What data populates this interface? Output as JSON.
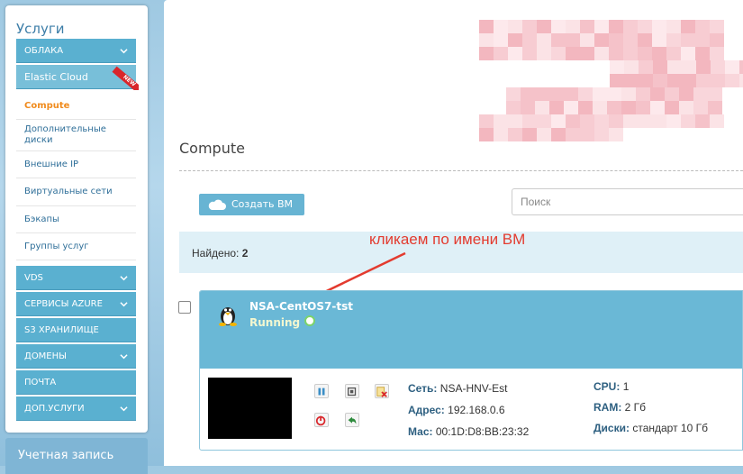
{
  "sidebar": {
    "title": "Услуги",
    "items": [
      {
        "label": "ОБЛАКА"
      },
      {
        "label": "Elastic Cloud",
        "badge": "NEW"
      }
    ],
    "subitems": [
      "Compute",
      "Дополнительные диски",
      "Внешние IP",
      "Виртуальные сети",
      "Бэкапы",
      "Группы услуг"
    ],
    "bottom_items": [
      "VDS",
      "СЕРВИСЫ AZURE",
      "S3 ХРАНИЛИЩЕ",
      "ДОМЕНЫ",
      "ПОЧТА",
      "ДОП.УСЛУГИ"
    ],
    "account_label": "Учетная запись"
  },
  "main": {
    "page_title": "Compute",
    "create_button": "Создать ВМ",
    "search_placeholder": "Поиск",
    "found_label": "Найдено:",
    "found_count": "2",
    "annotation": "кликаем по имени ВМ"
  },
  "vm": {
    "name": "NSA-CentOS7-tst",
    "status": "Running",
    "net_label": "Сеть:",
    "net_value": "NSA-HNV-Est",
    "addr_label": "Адрес:",
    "addr_value": "192.168.0.6",
    "mac_label": "Мас:",
    "mac_value": "00:1D:D8:BB:23:32",
    "cpu_label": "CPU:",
    "cpu_value": "1",
    "ram_label": "RAM:",
    "ram_value": "2 Гб",
    "disk_label": "Диски:",
    "disk_value": "стандарт 10 Гб"
  },
  "colors": {
    "accent": "#5ab0d0",
    "active": "#f08b1d",
    "annotation": "#e33b2f",
    "running": "#7cd36a"
  }
}
